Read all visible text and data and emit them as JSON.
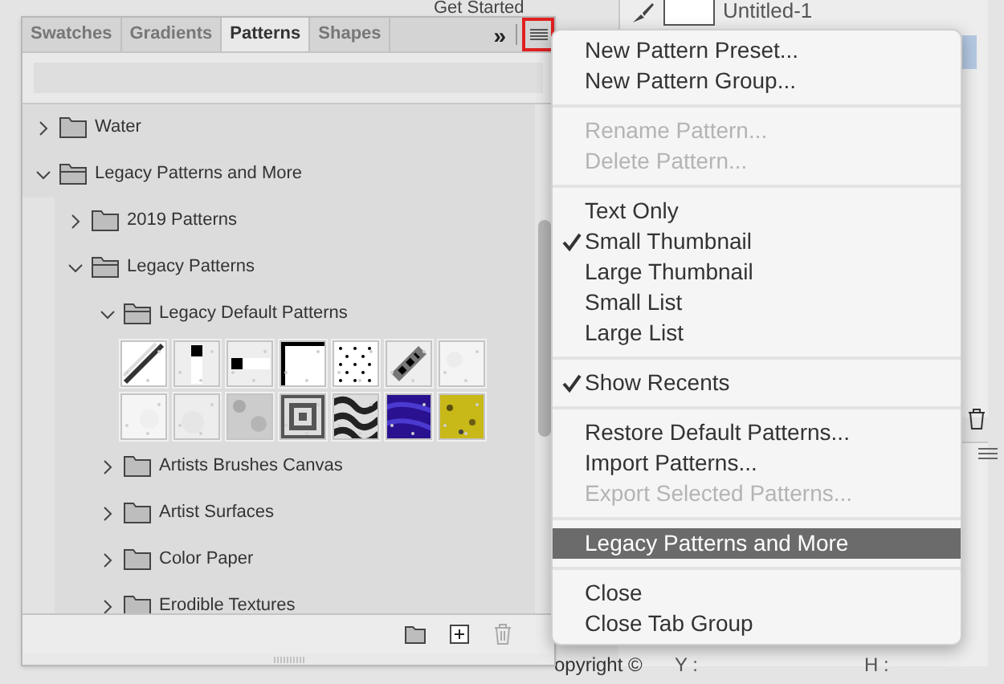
{
  "background": {
    "title": "Get Started",
    "document": "Untitled-1",
    "footer": "opyright ©",
    "y_label": "Y :",
    "h_label": "H :"
  },
  "panel": {
    "tabs": [
      {
        "label": "Swatches",
        "selected": false
      },
      {
        "label": "Gradients",
        "selected": false
      },
      {
        "label": "Patterns",
        "selected": true
      },
      {
        "label": "Shapes",
        "selected": false
      }
    ],
    "overflow": "»",
    "tree": [
      {
        "kind": "folder",
        "label": "Water",
        "expanded": false
      },
      {
        "kind": "folder",
        "label": "Legacy Patterns and More",
        "expanded": true,
        "children": [
          {
            "kind": "folder",
            "label": "2019 Patterns",
            "expanded": false
          },
          {
            "kind": "folder",
            "label": "Legacy Patterns",
            "expanded": true,
            "children": [
              {
                "kind": "folder",
                "label": "Legacy Default Patterns",
                "expanded": true,
                "children": [
                  {
                    "kind": "thumbnails"
                  }
                ]
              },
              {
                "kind": "folder",
                "label": "Artists Brushes Canvas",
                "expanded": false
              },
              {
                "kind": "folder",
                "label": "Artist Surfaces",
                "expanded": false
              },
              {
                "kind": "folder",
                "label": "Color Paper",
                "expanded": false
              },
              {
                "kind": "folder",
                "label": "Erodible Textures",
                "expanded": false
              }
            ]
          }
        ]
      }
    ]
  },
  "menu": [
    {
      "kind": "item",
      "label": "New Pattern Preset...",
      "checked": false,
      "disabled": false,
      "highlighted": false
    },
    {
      "kind": "item",
      "label": "New Pattern Group...",
      "checked": false,
      "disabled": false,
      "highlighted": false
    },
    {
      "kind": "separator"
    },
    {
      "kind": "item",
      "label": "Rename Pattern...",
      "checked": false,
      "disabled": true,
      "highlighted": false
    },
    {
      "kind": "item",
      "label": "Delete Pattern...",
      "checked": false,
      "disabled": true,
      "highlighted": false
    },
    {
      "kind": "separator"
    },
    {
      "kind": "item",
      "label": "Text Only",
      "checked": false,
      "disabled": false,
      "highlighted": false
    },
    {
      "kind": "item",
      "label": "Small Thumbnail",
      "checked": true,
      "disabled": false,
      "highlighted": false
    },
    {
      "kind": "item",
      "label": "Large Thumbnail",
      "checked": false,
      "disabled": false,
      "highlighted": false
    },
    {
      "kind": "item",
      "label": "Small List",
      "checked": false,
      "disabled": false,
      "highlighted": false
    },
    {
      "kind": "item",
      "label": "Large List",
      "checked": false,
      "disabled": false,
      "highlighted": false
    },
    {
      "kind": "separator"
    },
    {
      "kind": "item",
      "label": "Show Recents",
      "checked": true,
      "disabled": false,
      "highlighted": false
    },
    {
      "kind": "separator"
    },
    {
      "kind": "item",
      "label": "Restore Default Patterns...",
      "checked": false,
      "disabled": false,
      "highlighted": false
    },
    {
      "kind": "item",
      "label": "Import Patterns...",
      "checked": false,
      "disabled": false,
      "highlighted": false
    },
    {
      "kind": "item",
      "label": "Export Selected Patterns...",
      "checked": false,
      "disabled": true,
      "highlighted": false
    },
    {
      "kind": "separator"
    },
    {
      "kind": "item",
      "label": "Legacy Patterns and More",
      "checked": false,
      "disabled": false,
      "highlighted": true
    },
    {
      "kind": "separator"
    },
    {
      "kind": "item",
      "label": "Close",
      "checked": false,
      "disabled": false,
      "highlighted": false
    },
    {
      "kind": "item",
      "label": "Close Tab Group",
      "checked": false,
      "disabled": false,
      "highlighted": false
    }
  ]
}
